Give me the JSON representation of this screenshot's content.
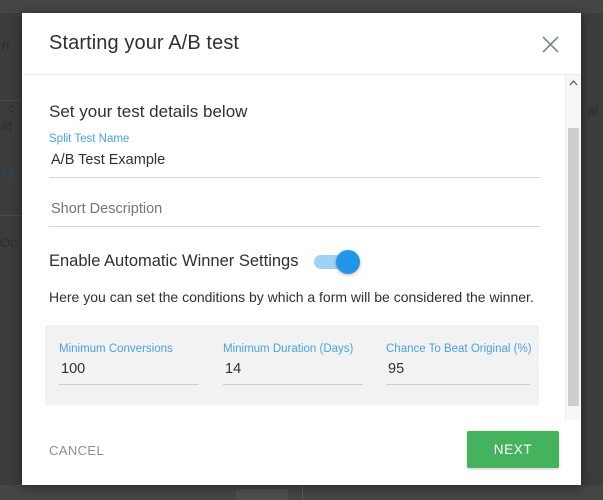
{
  "dialog": {
    "title": "Starting your A/B test",
    "close_icon": "close-icon",
    "section_title": "Set your test details below",
    "split_test_name": {
      "label": "Split Test Name",
      "value": "A/B Test Example"
    },
    "short_description": {
      "placeholder": "Short Description",
      "value": ""
    },
    "winner_toggle": {
      "label": "Enable Automatic Winner Settings",
      "state": "on",
      "track_color": "#9ed3f5",
      "knob_color": "#2196e8"
    },
    "winner_description": "Here you can set the conditions by which a form will be considered the winner.",
    "winner_settings": {
      "panel_background": "#f2f2f2",
      "fields": [
        {
          "label": "Minimum Conversions",
          "value": "100"
        },
        {
          "label": "Minimum Duration (Days)",
          "value": "14"
        },
        {
          "label": "Chance To Beat Original (%)",
          "value": "95"
        }
      ]
    },
    "scrollbar": {
      "up_arrow_icon": "chevron-up-icon"
    },
    "footer": {
      "cancel_label": "CANCEL",
      "next_label": "NEXT",
      "next_color": "#45b35d"
    }
  },
  "backdrop": {
    "fragments": [
      {
        "text": "ri"
      },
      {
        "text": "c"
      },
      {
        "text": "at"
      },
      {
        "text": "DI"
      },
      {
        "text": "Op"
      },
      {
        "text": "at"
      }
    ]
  }
}
